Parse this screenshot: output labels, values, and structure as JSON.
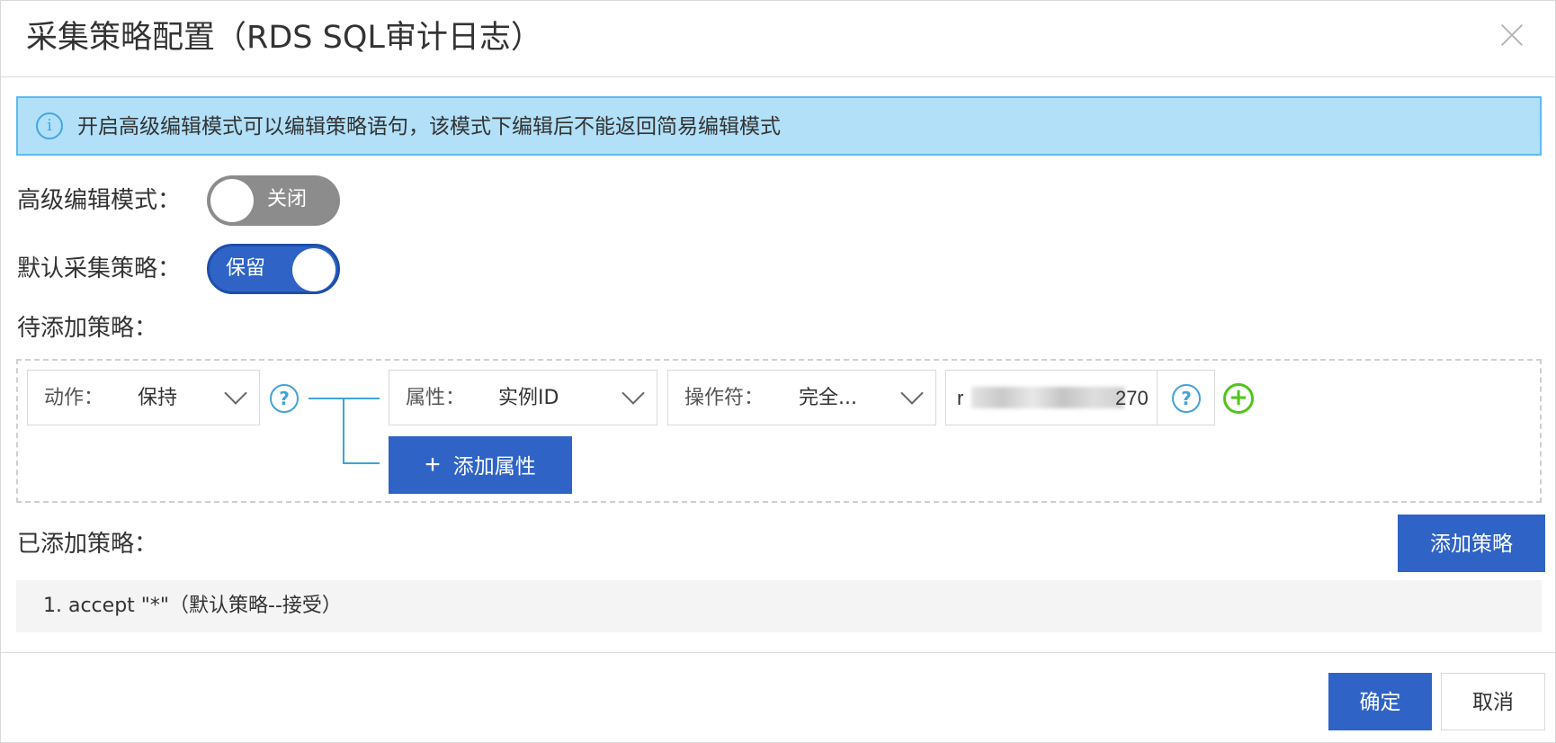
{
  "dialog": {
    "title": "采集策略配置（RDS SQL审计日志）"
  },
  "notice": {
    "text": "开启高级编辑模式可以编辑策略语句，该模式下编辑后不能返回简易编辑模式",
    "icon": "info-icon"
  },
  "advanced_mode": {
    "label": "高级编辑模式：",
    "state": "关闭",
    "on": false
  },
  "default_policy": {
    "label": "默认采集策略：",
    "state": "保留",
    "on": true
  },
  "pending": {
    "label": "待添加策略：",
    "action": {
      "label": "动作：",
      "value": "保持"
    },
    "attribute": {
      "label": "属性：",
      "value": "实例ID"
    },
    "operator": {
      "label": "操作符：",
      "value": "完全..."
    },
    "value_input": {
      "value": "r",
      "value_suffix": "270"
    },
    "add_attribute_button": "添加属性"
  },
  "added": {
    "label": "已添加策略：",
    "add_policy_button": "添加策略",
    "items": [
      "1. accept \"*\"（默认策略--接受）"
    ]
  },
  "footer": {
    "confirm": "确定",
    "cancel": "取消"
  },
  "colors": {
    "primary": "#2f63c6",
    "notice_bg": "#b1e0f8",
    "notice_border": "#5cbaf0",
    "help_icon": "#3fa3d8",
    "add_icon": "#52c41a",
    "switch_off": "#8c8c8c"
  }
}
